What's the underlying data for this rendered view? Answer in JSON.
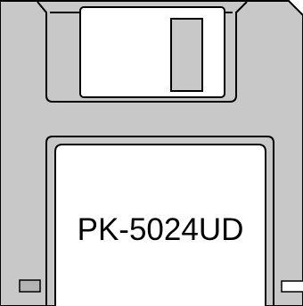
{
  "disk": {
    "label_text": "PK-5024UD",
    "body_color": "#c8c8c8",
    "edge_color": "#000000",
    "shutter_color": "#ffffff",
    "label_color": "#ffffff",
    "write_protect_color": "#b4b4b4"
  }
}
